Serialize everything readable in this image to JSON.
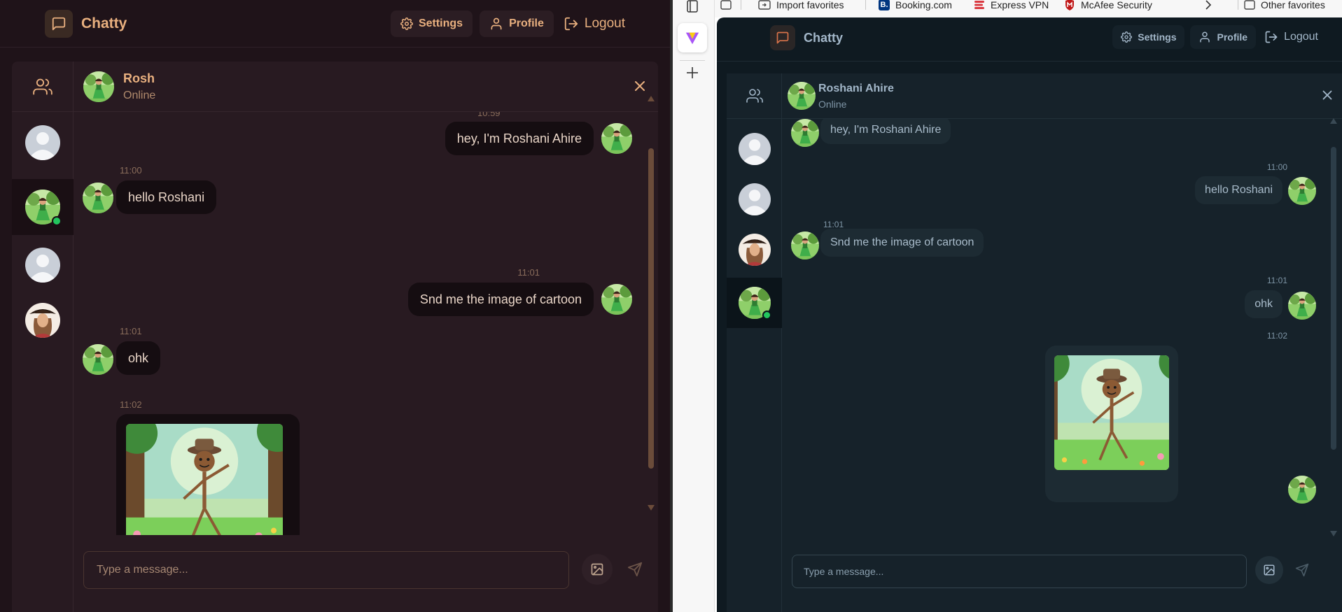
{
  "left": {
    "brand": "Chatty",
    "nav": {
      "settings": "Settings",
      "profile": "Profile",
      "logout": "Logout"
    },
    "chat": {
      "name": "Rosh",
      "status": "Online"
    },
    "top_partial_time": "10:59",
    "messages": [
      {
        "text": "hey, I'm Roshani Ahire",
        "side": "right"
      },
      {
        "time": "11:00",
        "text": "hello Roshani",
        "side": "left"
      },
      {
        "time": "11:01",
        "text": "Snd me the image of cartoon",
        "side": "right"
      },
      {
        "time": "11:01",
        "text": "ohk",
        "side": "left"
      },
      {
        "time": "11:02",
        "type": "image",
        "side": "left"
      }
    ],
    "composer": {
      "placeholder": "Type a message..."
    }
  },
  "browser": {
    "favorites": [
      {
        "label": "Import favorites"
      },
      {
        "label": "Booking.com",
        "badge": "B."
      },
      {
        "label": "Express VPN"
      },
      {
        "label": "McAfee Security"
      },
      {
        "label": "Other favorites"
      }
    ]
  },
  "right": {
    "brand": "Chatty",
    "nav": {
      "settings": "Settings",
      "profile": "Profile",
      "logout": "Logout"
    },
    "chat": {
      "name": "Roshani Ahire",
      "status": "Online"
    },
    "messages": [
      {
        "text": "hey, I'm Roshani Ahire",
        "side": "left"
      },
      {
        "time": "11:00",
        "text": "hello Roshani",
        "side": "right"
      },
      {
        "time": "11:01",
        "text": "Snd me the image of cartoon",
        "side": "left"
      },
      {
        "time": "11:01",
        "text": "ohk",
        "side": "right"
      },
      {
        "time": "11:02",
        "type": "image",
        "side": "right"
      }
    ],
    "composer": {
      "placeholder": "Type a message..."
    }
  },
  "colors": {
    "left_bg": "#1f1319",
    "left_accent": "#e9b07f",
    "right_bg": "#0f1a21",
    "right_accent": "#a3b7c9",
    "online": "#22c55e"
  },
  "icons": [
    "message-square-icon",
    "gear-icon",
    "user-icon",
    "logout-icon",
    "users-icon",
    "close-icon",
    "image-icon",
    "send-icon",
    "chevron-right-icon",
    "plus-icon"
  ]
}
